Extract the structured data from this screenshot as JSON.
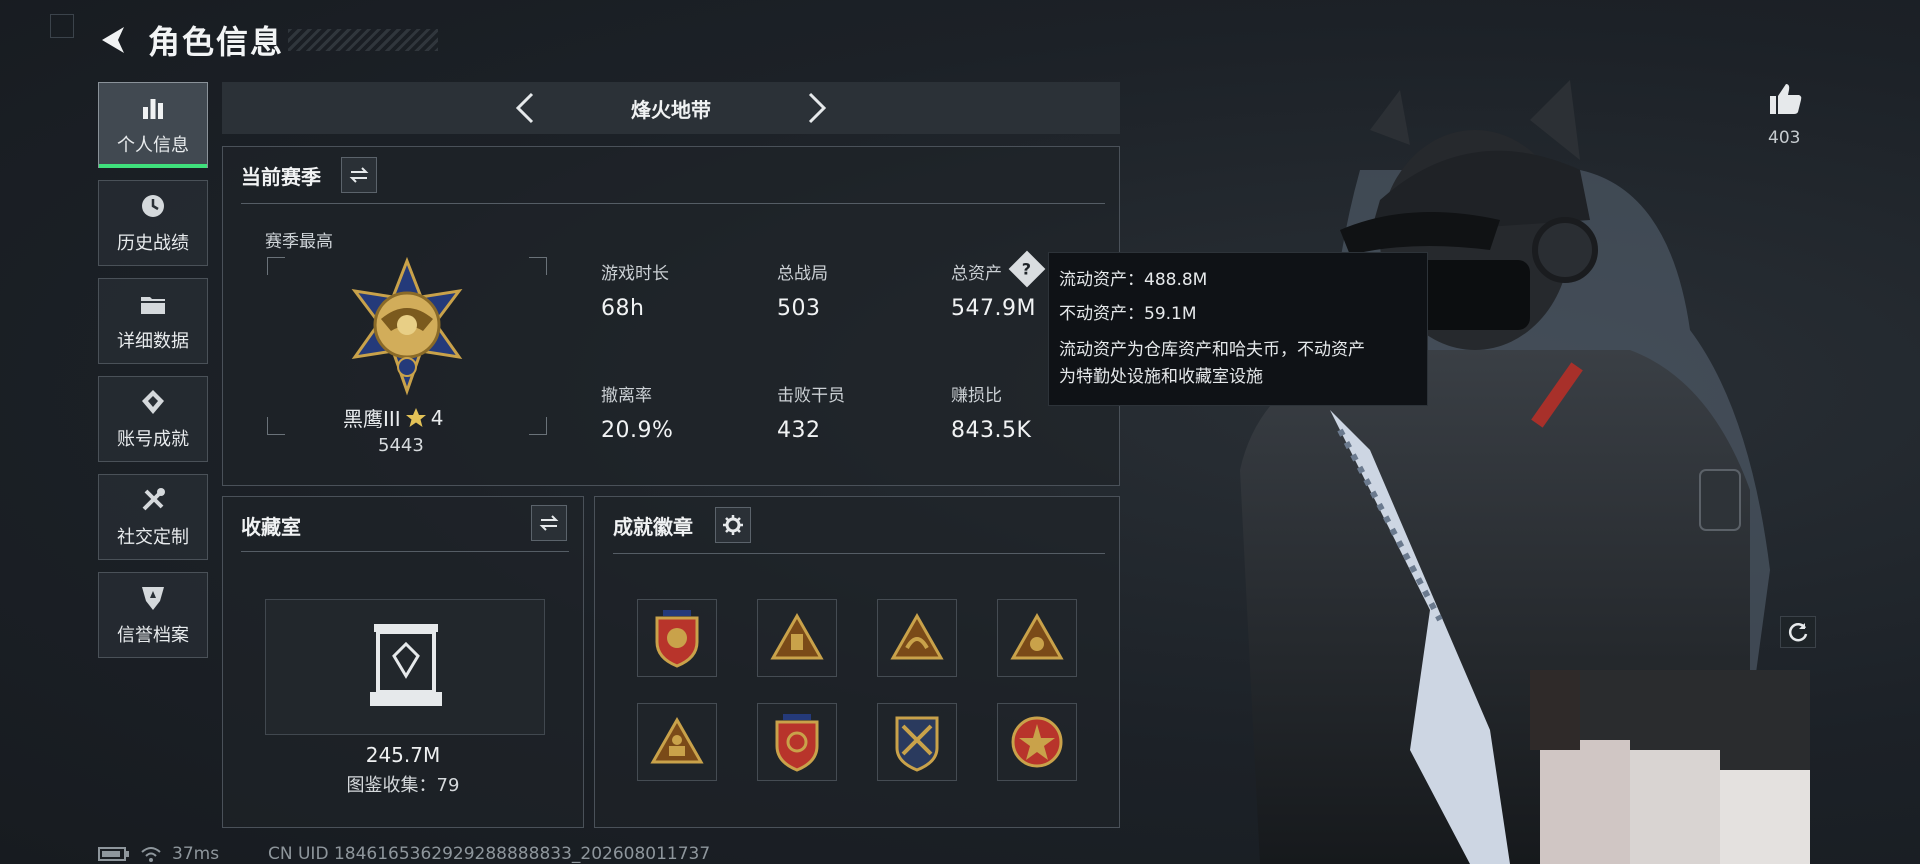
{
  "header": {
    "title": "角色信息"
  },
  "sidebar": {
    "items": [
      {
        "label": "个人信息",
        "icon": "bar-chart-icon",
        "active": true
      },
      {
        "label": "历史战绩",
        "icon": "history-icon",
        "active": false
      },
      {
        "label": "详细数据",
        "icon": "folder-icon",
        "active": false
      },
      {
        "label": "账号成就",
        "icon": "achievement-icon",
        "active": false
      },
      {
        "label": "社交定制",
        "icon": "tools-icon",
        "active": false
      },
      {
        "label": "信誉档案",
        "icon": "shield-icon",
        "active": false
      }
    ]
  },
  "season_bar": {
    "name": "烽火地带"
  },
  "season_panel": {
    "title": "当前赛季",
    "best_label": "赛季最高",
    "rank_name": "黑鹰III",
    "rank_stars": "4",
    "rank_score": "5443",
    "stats": [
      {
        "label": "游戏时长",
        "value": "68h"
      },
      {
        "label": "总战局",
        "value": "503"
      },
      {
        "label": "总资产",
        "value": "547.9M"
      },
      {
        "label": "撤离率",
        "value": "20.9%"
      },
      {
        "label": "击败干员",
        "value": "432"
      },
      {
        "label": "赚损比",
        "value": "843.5K"
      }
    ]
  },
  "tooltip": {
    "liquid": "流动资产：488.8M",
    "fixed": "不动资产：59.1M",
    "desc1": "流动资产为仓库资产和哈夫币，不动资产",
    "desc2": "为特勤处设施和收藏室设施"
  },
  "collection_panel": {
    "title": "收藏室",
    "value": "245.7M",
    "count": "图鉴收集：79"
  },
  "achievement_panel": {
    "title": "成就徽章"
  },
  "likes": {
    "count": "403"
  },
  "footer": {
    "ping": "37ms",
    "uid": "CN UID 1846165362929288888833_202608011737"
  },
  "colors": {
    "accent": "#3fe07c",
    "background": "#1b2026",
    "tooltip_bg": "#0f1216",
    "badge_gold": "#c9a24a",
    "badge_red": "#b8342b"
  }
}
